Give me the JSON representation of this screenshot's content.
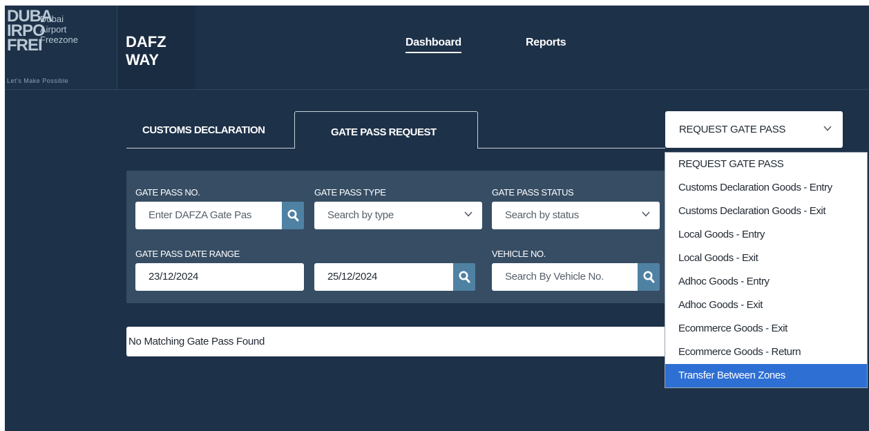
{
  "logo": {
    "lines": [
      "DUBA",
      "IRPO",
      "FREI"
    ],
    "small_lines": [
      "Dubai",
      "Airport",
      "Freezone"
    ],
    "tagline": "Let's Make Possible"
  },
  "brand": {
    "line1": "DAFZ",
    "line2": "WAY"
  },
  "nav": {
    "dashboard": "Dashboard",
    "reports": "Reports"
  },
  "tabs": {
    "customs": "CUSTOMS DECLARATION",
    "gatepass": "GATE PASS REQUEST"
  },
  "filters": {
    "gate_pass_no": {
      "label": "GATE PASS NO.",
      "placeholder": "Enter DAFZA Gate Pas"
    },
    "gate_pass_type": {
      "label": "GATE PASS TYPE",
      "value": "Search by type"
    },
    "gate_pass_status": {
      "label": "GATE PASS STATUS",
      "value": "Search by status"
    },
    "date_range": {
      "label": "GATE PASS DATE RANGE",
      "from": "23/12/2024",
      "to": "25/12/2024"
    },
    "vehicle_no": {
      "label": "VEHICLE NO.",
      "placeholder": "Search By Vehicle No."
    }
  },
  "result": {
    "message": "No Matching Gate Pass Found"
  },
  "request_dropdown": {
    "selected": "REQUEST GATE PASS",
    "options": [
      "REQUEST GATE PASS",
      "Customs Declaration Goods - Entry",
      "Customs Declaration Goods - Exit",
      "Local Goods - Entry",
      "Local Goods - Exit",
      "Adhoc Goods - Entry",
      "Adhoc Goods - Exit",
      "Ecommerce Goods - Exit",
      "Ecommerce Goods - Return",
      "Transfer Between Zones"
    ],
    "highlighted": "Transfer Between Zones"
  },
  "colors": {
    "background": "#1d3148",
    "panel": "#364d64",
    "search_button": "#4f81a3",
    "highlight": "#2e6fd4"
  },
  "icons": [
    "search-icon",
    "chevron-down-icon"
  ]
}
